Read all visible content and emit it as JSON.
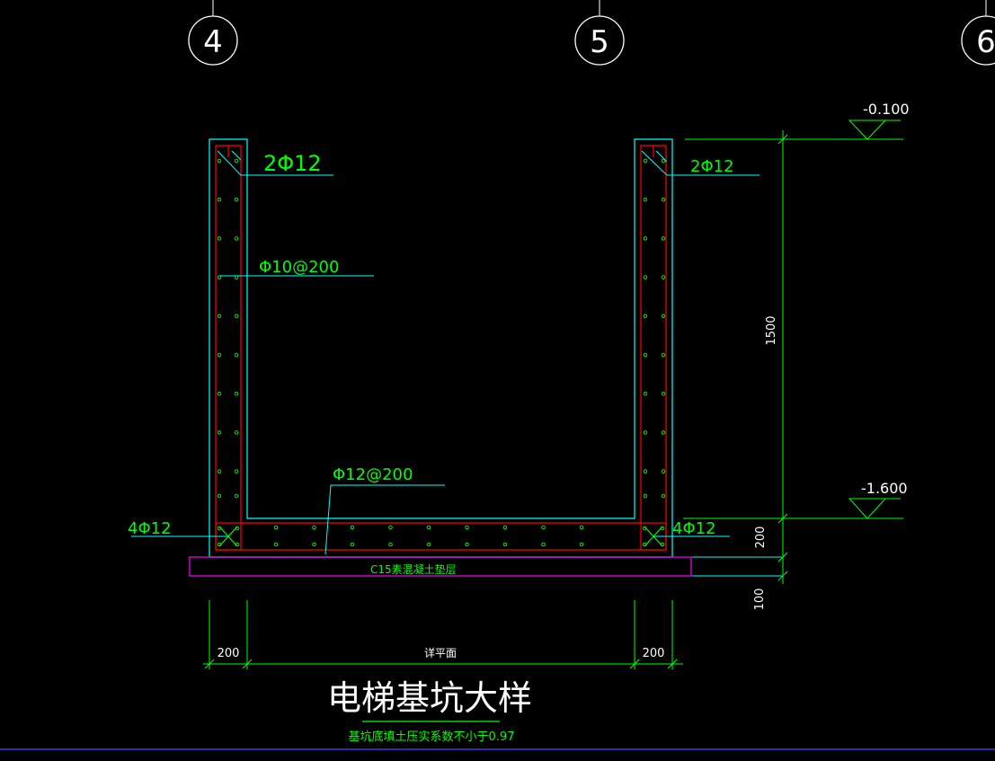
{
  "grid_axes": [
    "4",
    "5",
    "6"
  ],
  "elevations": {
    "top": "-0.100",
    "bottom": "-1.600"
  },
  "rebar_labels": {
    "left_top_corner": "2Φ12",
    "right_top_corner": "2Φ12",
    "wall_distribution": "Φ10@200",
    "slab_distribution": "Φ12@200",
    "left_bottom_corner": "4Φ12",
    "right_bottom_corner": "4Φ12"
  },
  "cushion_label": "C15素混凝土垫层",
  "dimensions": {
    "wall_height": "1500",
    "slab_thickness": "200",
    "cushion_thickness": "100",
    "left_wall_width": "200",
    "right_wall_width": "200",
    "clear_width": "详平面"
  },
  "title": "电梯基坑大样",
  "note": "基坑底填土压实系数不小于0.97",
  "colors": {
    "background": "#000000",
    "concrete_outline": "#00ffff",
    "rebar": "#ff0000",
    "annotation": "#00ff00",
    "cushion": "#ff00ff",
    "axis": "#ffffff",
    "leader": "#00ffff"
  }
}
